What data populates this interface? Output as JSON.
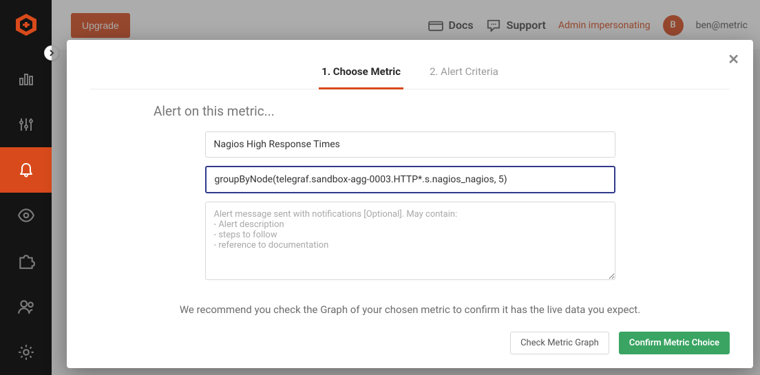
{
  "sidebar": {
    "logo_name": "logo",
    "items": [
      {
        "name": "dashboards"
      },
      {
        "name": "metrics"
      },
      {
        "name": "alerts",
        "active": true
      },
      {
        "name": "watch"
      },
      {
        "name": "integrations"
      },
      {
        "name": "users"
      },
      {
        "name": "settings"
      }
    ]
  },
  "topbar": {
    "upgrade": "Upgrade",
    "docs": "Docs",
    "support": "Support",
    "impersonating": "Admin impersonating",
    "avatar_initial": "B",
    "user_email": "ben@metric"
  },
  "modal": {
    "close": "✕",
    "tabs": [
      {
        "label": "1. Choose Metric",
        "active": true
      },
      {
        "label": "2. Alert Criteria",
        "active": false
      }
    ],
    "section_title": "Alert on this metric...",
    "name_value": "Nagios High Response Times",
    "metric_value": "groupByNode(telegraf.sandbox-agg-0003.HTTP*.s.nagios_nagios, 5)",
    "message_placeholder": "Alert message sent with notifications [Optional]. May contain:\n- Alert description\n- steps to follow\n- reference to documentation",
    "recommend_text": "We recommend you check the Graph of your chosen metric to confirm it has the live data you expect.",
    "check_btn": "Check Metric Graph",
    "confirm_btn": "Confirm Metric Choice"
  }
}
